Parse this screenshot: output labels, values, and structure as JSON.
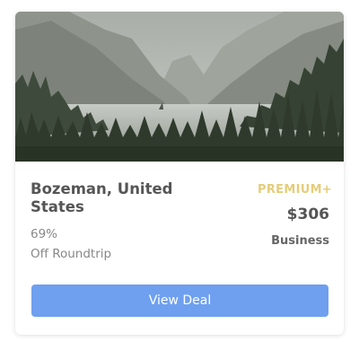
{
  "card": {
    "image_alt": "Mountain lake landscape with pine forest",
    "destination": "Bozeman, United States",
    "discount": "69%",
    "trip_type": "Off Roundtrip",
    "tier_badge": "PREMIUM+",
    "price": "$306",
    "cabin_class": "Business",
    "cta_label": "View Deal"
  },
  "colors": {
    "button_bg": "#6ea0ef",
    "tier_badge": "#e4cd7a",
    "heading_text": "#555555",
    "muted_text": "#888888"
  }
}
